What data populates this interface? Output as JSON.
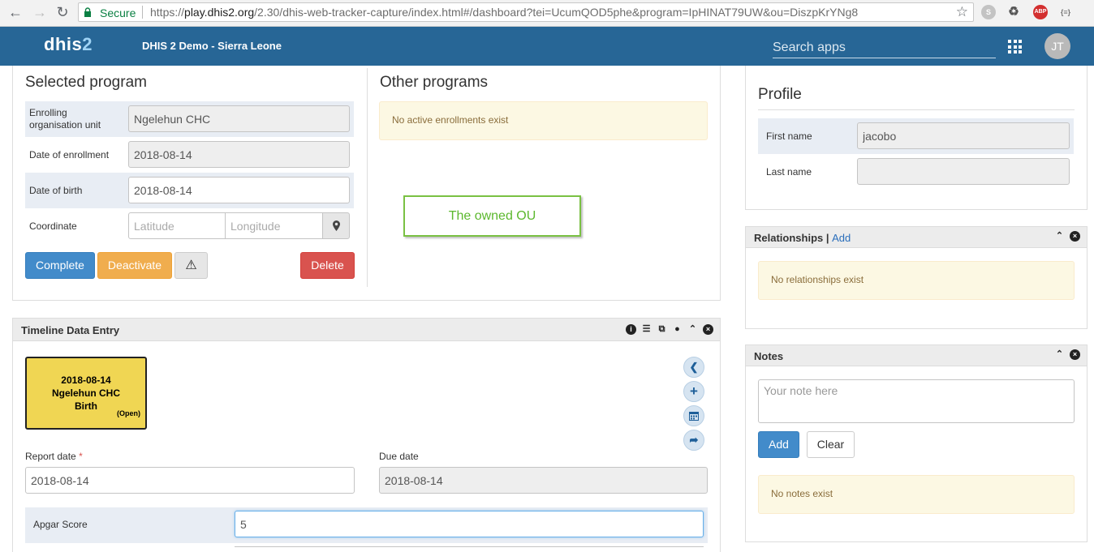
{
  "browser": {
    "secure_label": "Secure",
    "url_scheme": "https://",
    "url_host": "play.dhis2.org",
    "url_path": "/2.30/dhis-web-tracker-capture/index.html#/dashboard?tei=UcumQOD5phe&program=IpHINAT79UW&ou=DiszpKrYNg8",
    "ext_abp": "ABP",
    "ext_code": "{≡}"
  },
  "header": {
    "logo_main": "dhis",
    "logo_num": "2",
    "instance_name": "DHIS 2 Demo - Sierra Leone",
    "search_placeholder": "Search apps",
    "avatar_initials": "JT"
  },
  "selected_program": {
    "title": "Selected program",
    "fields": [
      {
        "label": "Enrolling organisation unit",
        "value": "Ngelehun CHC"
      },
      {
        "label": "Date of enrollment",
        "value": "2018-08-14"
      },
      {
        "label": "Date of birth",
        "value": "2018-08-14"
      },
      {
        "label": "Coordinate",
        "lat_placeholder": "Latitude",
        "lon_placeholder": "Longitude"
      }
    ],
    "buttons": {
      "complete": "Complete",
      "deactivate": "Deactivate",
      "warning": "⚠",
      "delete": "Delete"
    }
  },
  "other_programs": {
    "title": "Other programs",
    "empty_text": "No active enrollments exist"
  },
  "annotation": {
    "text": "The owned OU"
  },
  "profile": {
    "title": "Profile",
    "fields": [
      {
        "label": "First name",
        "value": "jacobo"
      },
      {
        "label": "Last name",
        "value": ""
      }
    ]
  },
  "relationships": {
    "title": "Relationships",
    "separator": "|",
    "add_link": "Add",
    "empty_text": "No relationships exist"
  },
  "timeline": {
    "title": "Timeline Data Entry",
    "event": {
      "date": "2018-08-14",
      "org_unit": "Ngelehun CHC",
      "stage": "Birth",
      "status": "(Open)"
    },
    "report_date_label": "Report date",
    "report_date_required": "*",
    "report_date_value": "2018-08-14",
    "due_date_label": "Due date",
    "due_date_value": "2018-08-14",
    "data_elements": [
      {
        "label": "Apgar Score",
        "value": "5"
      }
    ]
  },
  "notes": {
    "title": "Notes",
    "placeholder": "Your note here",
    "add_button": "Add",
    "clear_button": "Clear",
    "empty_text": "No notes exist"
  },
  "colors": {
    "header_bg": "#276696",
    "event_card": "#f0d653",
    "owned_ou_border": "#7ac143"
  }
}
